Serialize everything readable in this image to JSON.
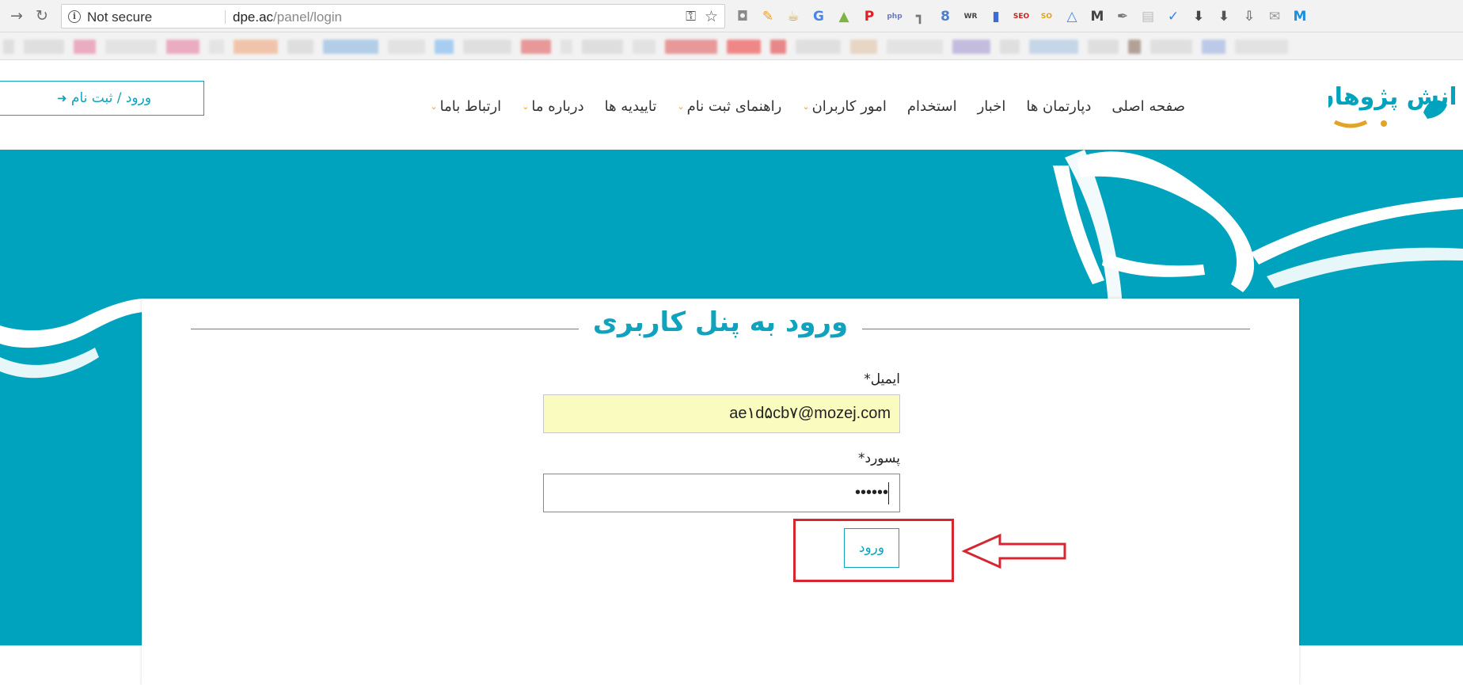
{
  "browser": {
    "security_label": "Not secure",
    "url_host": "dpe.ac",
    "url_path": "/panel/login",
    "extensions": [
      {
        "icon": "camera-icon",
        "glyph": "◘",
        "color": "#8a8a8a"
      },
      {
        "icon": "eyedropper-icon",
        "glyph": "✎",
        "color": "#f0a020"
      },
      {
        "icon": "mug-icon",
        "glyph": "☕",
        "color": "#e0a520"
      },
      {
        "icon": "translate-icon",
        "glyph": "G",
        "color": "#4a86e8"
      },
      {
        "icon": "android-icon",
        "glyph": "▲",
        "color": "#7cb342"
      },
      {
        "icon": "pinterest-icon",
        "glyph": "P",
        "color": "#e02020"
      },
      {
        "icon": "php-icon",
        "glyph": "php",
        "color": "#6c7bb5"
      },
      {
        "icon": "tool-icon",
        "glyph": "┓",
        "color": "#777777"
      },
      {
        "icon": "clipper-icon",
        "glyph": "8",
        "color": "#4f7ec8"
      },
      {
        "icon": "wr-icon",
        "glyph": "WR",
        "color": "#444444"
      },
      {
        "icon": "bars-icon",
        "glyph": "▮",
        "color": "#3d6ad6"
      },
      {
        "icon": "seo-icon",
        "glyph": "SEO",
        "color": "#c8211e"
      },
      {
        "icon": "so-icon",
        "glyph": "SO",
        "color": "#e2a510"
      },
      {
        "icon": "drive-icon",
        "glyph": "△",
        "color": "#4a86e8"
      },
      {
        "icon": "m-icon",
        "glyph": "M",
        "color": "#444444"
      },
      {
        "icon": "pen-icon",
        "glyph": "✒",
        "color": "#777777"
      },
      {
        "icon": "note-icon",
        "glyph": "▤",
        "color": "#bbbbbb"
      },
      {
        "icon": "check-icon",
        "glyph": "✓",
        "color": "#3b7fe0"
      },
      {
        "icon": "download-icon",
        "glyph": "⬇",
        "color": "#444444"
      },
      {
        "icon": "save-icon",
        "glyph": "⬇",
        "color": "#555555"
      },
      {
        "icon": "upload-icon",
        "glyph": "⇩",
        "color": "#777777"
      },
      {
        "icon": "mail-icon",
        "glyph": "✉",
        "color": "#999999"
      },
      {
        "icon": "maxthon-icon",
        "glyph": "M",
        "color": "#1a8fe0"
      }
    ]
  },
  "header": {
    "login_register_label": "ورود / ثبت نام",
    "nav": [
      {
        "label": "صفحه اصلی",
        "dropdown": false
      },
      {
        "label": "دپارتمان ها",
        "dropdown": false
      },
      {
        "label": "اخبار",
        "dropdown": false
      },
      {
        "label": "استخدام",
        "dropdown": false
      },
      {
        "label": "امور کاربران",
        "dropdown": true
      },
      {
        "label": "راهنمای ثبت نام",
        "dropdown": true
      },
      {
        "label": "تاییدیه ها",
        "dropdown": false
      },
      {
        "label": "درباره ما",
        "dropdown": true
      },
      {
        "label": "ارتباط باما",
        "dropdown": true
      }
    ],
    "logo_text": "دانش پژوهان"
  },
  "login": {
    "title": "ورود به پنل کاربری",
    "email_label": "ایمیل*",
    "email_value": "ae١d۵cb٧@mozej.com",
    "password_label": "پسورد*",
    "password_value": "••••••",
    "submit_label": "ورود"
  },
  "colors": {
    "brand": "#00a3bd",
    "accent": "#e1a328",
    "annotation": "#d6262f"
  }
}
